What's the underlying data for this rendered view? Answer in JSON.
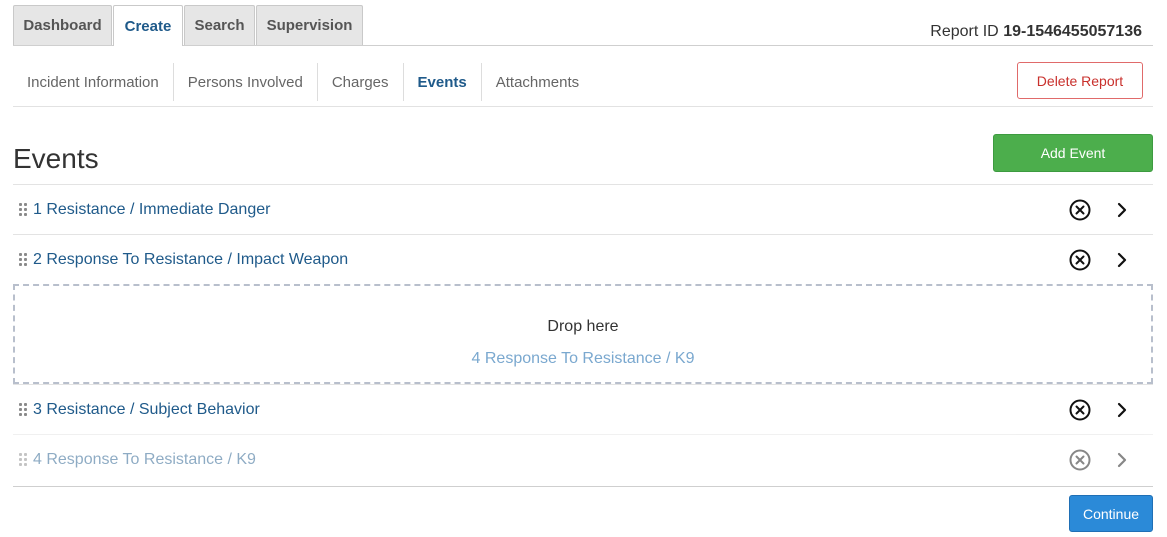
{
  "top_tabs": [
    {
      "label": "Dashboard",
      "active": false
    },
    {
      "label": "Create",
      "active": true
    },
    {
      "label": "Search",
      "active": false
    },
    {
      "label": "Supervision",
      "active": false
    }
  ],
  "report": {
    "id_label": "Report ID",
    "id_value": "19-1546455057136"
  },
  "subnav": [
    {
      "label": "Incident Information",
      "active": false
    },
    {
      "label": "Persons Involved",
      "active": false
    },
    {
      "label": "Charges",
      "active": false
    },
    {
      "label": "Events",
      "active": true
    },
    {
      "label": "Attachments",
      "active": false
    }
  ],
  "buttons": {
    "delete_report": "Delete Report",
    "add_event": "Add Event",
    "continue": "Continue"
  },
  "page_title": "Events",
  "events": [
    {
      "label": "1 Resistance / Immediate Danger",
      "dragging": false
    },
    {
      "label": "2 Response To Resistance / Impact Weapon",
      "dragging": false
    },
    {
      "label": "3 Resistance / Subject Behavior",
      "dragging": false
    },
    {
      "label": "4 Response To Resistance / K9",
      "dragging": true
    }
  ],
  "dropzone": {
    "text": "Drop here",
    "ghost_label": "4 Response To Resistance / K9"
  },
  "icons": {
    "remove": "remove-circle-icon",
    "open": "chevron-right-icon",
    "drag": "drag-handle-icon"
  },
  "colors": {
    "link": "#1f5a8a",
    "add_button": "#4cae4c",
    "continue_button": "#2b8ad8",
    "delete_border": "#e06a6a"
  }
}
